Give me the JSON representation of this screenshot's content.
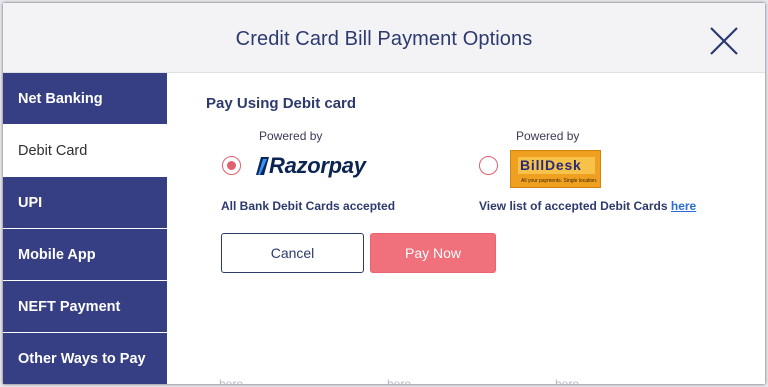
{
  "modal": {
    "title": "Credit Card Bill Payment Options",
    "close_icon": "close-icon"
  },
  "sidebar": {
    "items": [
      {
        "label": "Net Banking",
        "active": false
      },
      {
        "label": "Debit Card",
        "active": true
      },
      {
        "label": "UPI",
        "active": false
      },
      {
        "label": "Mobile App",
        "active": false
      },
      {
        "label": "NEFT Payment",
        "active": false
      },
      {
        "label": "Other Ways to Pay",
        "active": false
      }
    ]
  },
  "content": {
    "section_title": "Pay Using Debit card",
    "options": [
      {
        "powered_by": "Powered by",
        "provider": "Razorpay",
        "selected": true,
        "note": "All Bank Debit Cards accepted"
      },
      {
        "powered_by": "Powered by",
        "provider": "BillDesk",
        "tagline": "All your payments. Single location.",
        "selected": false,
        "note": "View list of accepted Debit Cards",
        "link": "here"
      }
    ],
    "cancel_label": "Cancel",
    "pay_label": "Pay Now",
    "ghost_links": [
      "here",
      "here",
      "here"
    ]
  },
  "colors": {
    "sidebar_bg": "#363e84",
    "title_color": "#2d3a6e",
    "pay_button": "#f0707c",
    "radio_accent": "#e0606d",
    "link": "#2a6cd6"
  }
}
